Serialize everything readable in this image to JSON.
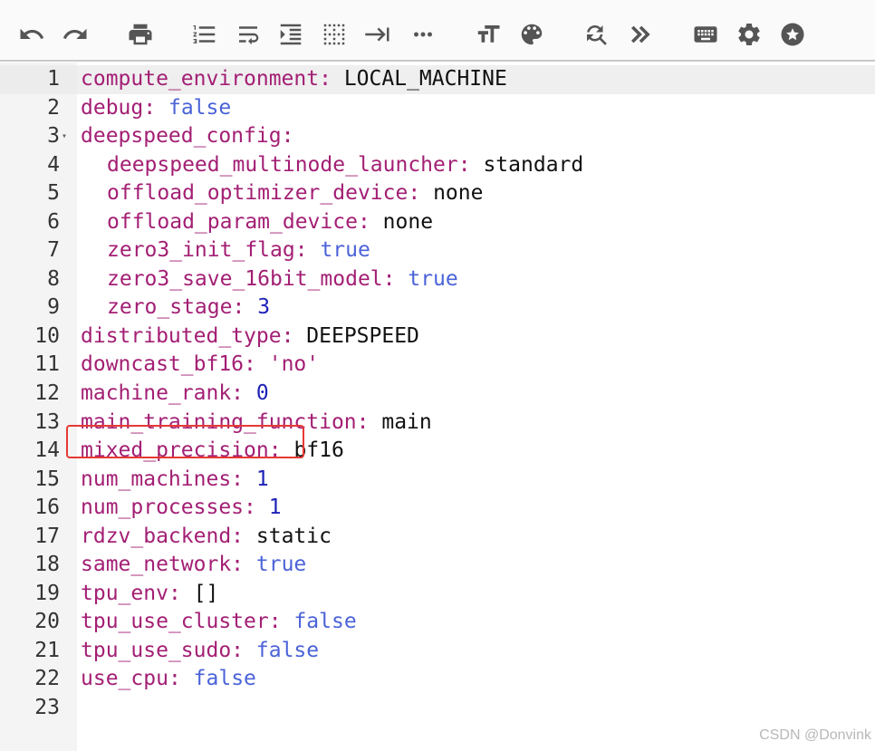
{
  "toolbar": {
    "buttons": [
      {
        "icon": "undo-icon"
      },
      {
        "icon": "redo-icon"
      },
      {
        "icon": "print-icon"
      },
      {
        "icon": "line-numbers-icon"
      },
      {
        "icon": "word-wrap-icon"
      },
      {
        "icon": "indent-icon"
      },
      {
        "icon": "whitespace-grid-icon"
      },
      {
        "icon": "tab-icon"
      },
      {
        "icon": "more-dots-icon"
      },
      {
        "icon": "font-size-icon"
      },
      {
        "icon": "palette-icon"
      },
      {
        "icon": "search-replace-icon"
      },
      {
        "icon": "double-chevron-right-icon"
      },
      {
        "icon": "keyboard-icon"
      },
      {
        "icon": "gear-icon"
      },
      {
        "icon": "star-icon"
      }
    ]
  },
  "editor": {
    "active_line": 1,
    "highlighted_line": 16,
    "lines": [
      {
        "n": "1",
        "indent": false,
        "key": "compute_environment",
        "value": "LOCAL_MACHINE",
        "vtype": "plain"
      },
      {
        "n": "2",
        "indent": false,
        "key": "debug",
        "value": "false",
        "vtype": "bool"
      },
      {
        "n": "3",
        "indent": false,
        "key": "deepspeed_config",
        "value": "",
        "vtype": "plain",
        "fold": "▾"
      },
      {
        "n": "4",
        "indent": true,
        "key": "deepspeed_multinode_launcher",
        "value": "standard",
        "vtype": "plain"
      },
      {
        "n": "5",
        "indent": true,
        "key": "offload_optimizer_device",
        "value": "none",
        "vtype": "plain"
      },
      {
        "n": "6",
        "indent": true,
        "key": "offload_param_device",
        "value": "none",
        "vtype": "plain"
      },
      {
        "n": "7",
        "indent": true,
        "key": "zero3_init_flag",
        "value": "true",
        "vtype": "bool"
      },
      {
        "n": "8",
        "indent": true,
        "key": "zero3_save_16bit_model",
        "value": "true",
        "vtype": "bool"
      },
      {
        "n": "9",
        "indent": true,
        "key": "zero_stage",
        "value": "3",
        "vtype": "num"
      },
      {
        "n": "10",
        "indent": false,
        "key": "distributed_type",
        "value": "DEEPSPEED",
        "vtype": "plain"
      },
      {
        "n": "11",
        "indent": false,
        "key": "downcast_bf16",
        "value": "'no'",
        "vtype": "str"
      },
      {
        "n": "12",
        "indent": false,
        "key": "machine_rank",
        "value": "0",
        "vtype": "num"
      },
      {
        "n": "13",
        "indent": false,
        "key": "main_training_function",
        "value": "main",
        "vtype": "plain"
      },
      {
        "n": "14",
        "indent": false,
        "key": "mixed_precision",
        "value": "bf16",
        "vtype": "plain"
      },
      {
        "n": "15",
        "indent": false,
        "key": "num_machines",
        "value": "1",
        "vtype": "num"
      },
      {
        "n": "16",
        "indent": false,
        "key": "num_processes",
        "value": "1",
        "vtype": "num"
      },
      {
        "n": "17",
        "indent": false,
        "key": "rdzv_backend",
        "value": "static",
        "vtype": "plain"
      },
      {
        "n": "18",
        "indent": false,
        "key": "same_network",
        "value": "true",
        "vtype": "bool"
      },
      {
        "n": "19",
        "indent": false,
        "key": "tpu_env",
        "value": "[]",
        "vtype": "plain"
      },
      {
        "n": "20",
        "indent": false,
        "key": "tpu_use_cluster",
        "value": "false",
        "vtype": "bool"
      },
      {
        "n": "21",
        "indent": false,
        "key": "tpu_use_sudo",
        "value": "false",
        "vtype": "bool"
      },
      {
        "n": "22",
        "indent": false,
        "key": "use_cpu",
        "value": "false",
        "vtype": "bool"
      },
      {
        "n": "23",
        "indent": false,
        "key": "",
        "value": "",
        "vtype": "plain"
      }
    ]
  },
  "watermark": "CSDN @Donvink",
  "colors": {
    "key": "#a31f74",
    "bool": "#4b63d8",
    "number": "#1e22b8",
    "highlight_box": "#e53935"
  }
}
